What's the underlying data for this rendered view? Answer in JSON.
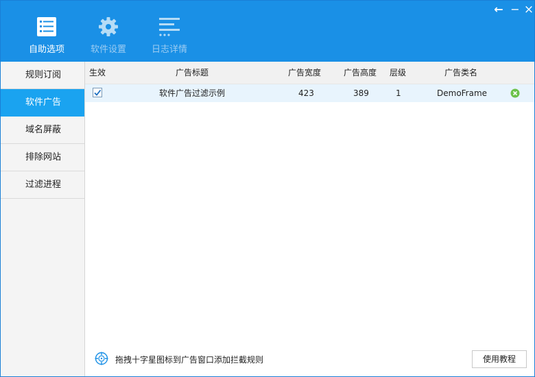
{
  "window_controls": {
    "back": "←",
    "minimize": "−",
    "close": "×"
  },
  "toolbar": [
    {
      "label": "自助选项",
      "icon": "checklist-icon",
      "active": true
    },
    {
      "label": "软件设置",
      "icon": "gear-icon",
      "active": false
    },
    {
      "label": "日志详情",
      "icon": "log-lines-icon",
      "active": false
    }
  ],
  "sidebar": {
    "items": [
      {
        "label": "规则订阅"
      },
      {
        "label": "软件广告",
        "active": true
      },
      {
        "label": "域名屏蔽"
      },
      {
        "label": "排除网站"
      },
      {
        "label": "过滤进程"
      }
    ]
  },
  "table": {
    "columns": [
      "生效",
      "广告标题",
      "广告宽度",
      "广告高度",
      "层级",
      "广告类名"
    ],
    "rows": [
      {
        "enabled": true,
        "title": "软件广告过滤示例",
        "width": "423",
        "height": "389",
        "level": "1",
        "classname": "DemoFrame"
      }
    ]
  },
  "footer": {
    "hint": "拖拽十字星图标到广告窗口添加拦截规则",
    "guide_button": "使用教程"
  },
  "colors": {
    "header_blue": "#1a90e6",
    "active_tab": "#1aa3f0",
    "row_highlight": "#e8f4fd",
    "delete_green": "#6cc24a"
  }
}
